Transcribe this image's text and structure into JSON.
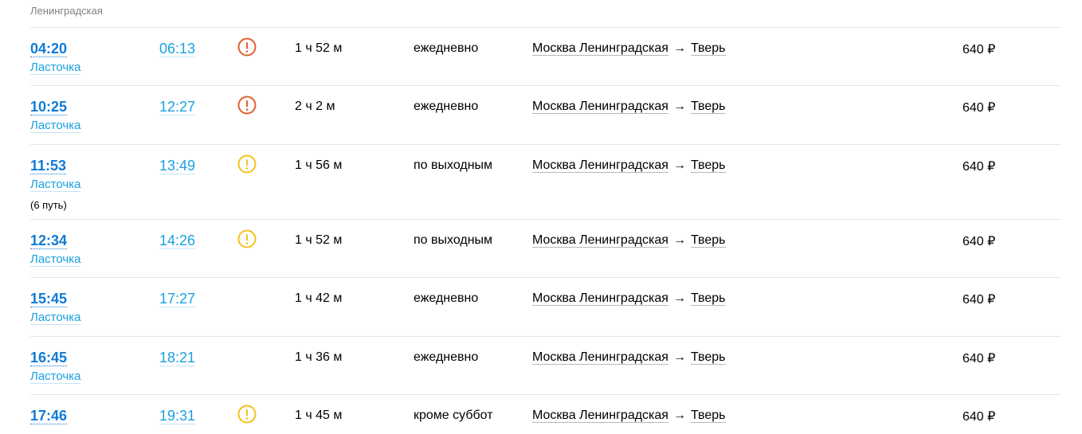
{
  "header": {
    "departure_station": "Ленинградская"
  },
  "colors": {
    "link": "#0f7bd6",
    "link_light": "#1aa0e0",
    "warn_red": "#e0602f",
    "warn_yellow": "#f2c21c"
  },
  "rows": [
    {
      "departure": "04:20",
      "train": "Ласточка",
      "platform": "",
      "arrival": "06:13",
      "alert": "red",
      "duration": "1 ч 52 м",
      "days": "ежедневно",
      "from": "Москва Ленинградская",
      "arrow": "→",
      "to": "Тверь",
      "price": "640 ₽"
    },
    {
      "departure": "10:25",
      "train": "Ласточка",
      "platform": "",
      "arrival": "12:27",
      "alert": "red",
      "duration": "2 ч 2 м",
      "days": "ежедневно",
      "from": "Москва Ленинградская",
      "arrow": "→",
      "to": "Тверь",
      "price": "640 ₽"
    },
    {
      "departure": "11:53",
      "train": "Ласточка",
      "platform": "(6 путь)",
      "arrival": "13:49",
      "alert": "yellow",
      "duration": "1 ч 56 м",
      "days": "по выходным",
      "from": "Москва Ленинградская",
      "arrow": "→",
      "to": "Тверь",
      "price": "640 ₽"
    },
    {
      "departure": "12:34",
      "train": "Ласточка",
      "platform": "",
      "arrival": "14:26",
      "alert": "yellow",
      "duration": "1 ч 52 м",
      "days": "по выходным",
      "from": "Москва Ленинградская",
      "arrow": "→",
      "to": "Тверь",
      "price": "640 ₽"
    },
    {
      "departure": "15:45",
      "train": "Ласточка",
      "platform": "",
      "arrival": "17:27",
      "alert": "",
      "duration": "1 ч 42 м",
      "days": "ежедневно",
      "from": "Москва Ленинградская",
      "arrow": "→",
      "to": "Тверь",
      "price": "640 ₽"
    },
    {
      "departure": "16:45",
      "train": "Ласточка",
      "platform": "",
      "arrival": "18:21",
      "alert": "",
      "duration": "1 ч 36 м",
      "days": "ежедневно",
      "from": "Москва Ленинградская",
      "arrow": "→",
      "to": "Тверь",
      "price": "640 ₽"
    },
    {
      "departure": "17:46",
      "train": "",
      "platform": "",
      "arrival": "19:31",
      "alert": "yellow",
      "duration": "1 ч 45 м",
      "days": "кроме суббот",
      "from": "Москва Ленинградская",
      "arrow": "→",
      "to": "Тверь",
      "price": "640 ₽"
    }
  ]
}
